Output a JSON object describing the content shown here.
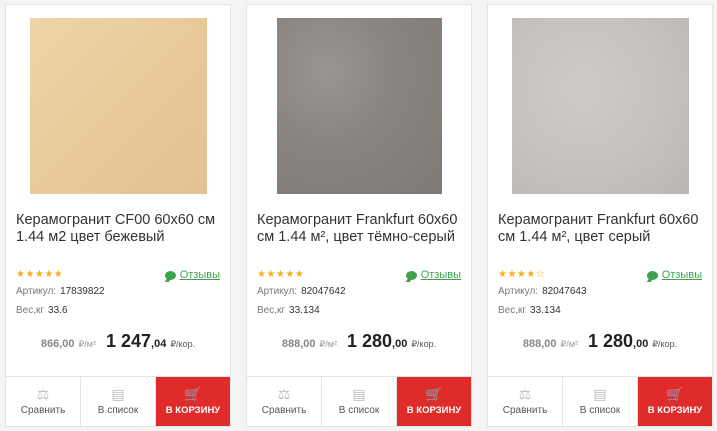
{
  "products": [
    {
      "title": "Керамогранит CF00 60x60 см 1.44 м2 цвет бежевый",
      "rating": "★★★★★",
      "reviews": "Отзывы",
      "article_label": "Артикул:",
      "article": "17839822",
      "weight_label": "Вес,кг",
      "weight": "33.6",
      "price_m2": "866,00",
      "unit_m2": "₽/м²",
      "price_box": "1 247",
      "price_box_cents": ",04",
      "unit_box": "₽/кор.",
      "compare": "Сравнить",
      "list": "В список",
      "cart": "В КОРЗИНУ"
    },
    {
      "title": "Керамогранит Frankfurt 60x60 см 1.44 м², цвет тёмно-серый",
      "rating": "★★★★★",
      "reviews": "Отзывы",
      "article_label": "Артикул:",
      "article": "82047642",
      "weight_label": "Вес,кг",
      "weight": "33.134",
      "price_m2": "888,00",
      "unit_m2": "₽/м²",
      "price_box": "1 280",
      "price_box_cents": ",00",
      "unit_box": "₽/кор.",
      "compare": "Сравнить",
      "list": "В список",
      "cart": "В КОРЗИНУ"
    },
    {
      "title": "Керамогранит Frankfurt 60x60 см 1.44 м², цвет серый",
      "rating": "★★★★☆",
      "reviews": "Отзывы",
      "article_label": "Артикул:",
      "article": "82047643",
      "weight_label": "Вес,кг",
      "weight": "33.134",
      "price_m2": "888,00",
      "unit_m2": "₽/м²",
      "price_box": "1 280",
      "price_box_cents": ",00",
      "unit_box": "₽/кор.",
      "compare": "Сравнить",
      "list": "В список",
      "cart": "В КОРЗИНУ"
    }
  ],
  "icons": {
    "reviews": "speech-bubble-icon",
    "compare": "scales-icon",
    "list": "list-icon",
    "cart": "cart-icon"
  },
  "colors": {
    "accent": "#e02b2b",
    "stars": "#f2b01e",
    "reviews": "#3fa34d"
  }
}
